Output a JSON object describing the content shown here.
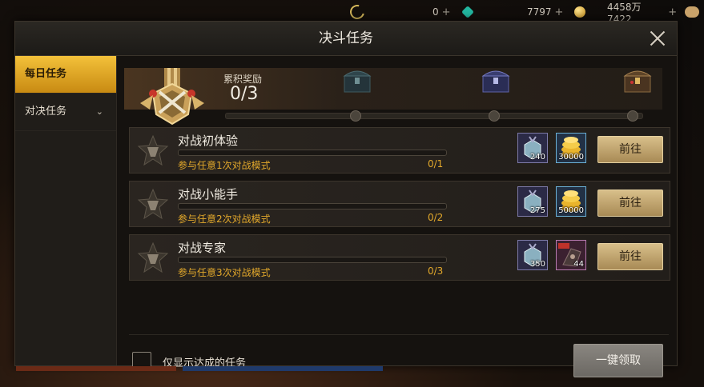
{
  "currencies": [
    {
      "icon": "moon-currency-icon",
      "value": "",
      "plus": ""
    },
    {
      "icon": "gem-currency-icon",
      "value": "0",
      "plus": "+"
    },
    {
      "icon": "diamond-currency-icon",
      "value": "7797",
      "plus": "+"
    },
    {
      "icon": "gold-coin-icon",
      "value": "4458万7422",
      "plus": "+"
    }
  ],
  "dialog": {
    "title": "决斗任务"
  },
  "sidebar": {
    "items": [
      {
        "label": "每日任务",
        "active": true
      },
      {
        "label": "对决任务",
        "chevron": "⌄"
      }
    ]
  },
  "accumulated": {
    "label": "累积奖励",
    "value": "0/3",
    "milestones": [
      "1",
      "2",
      "3"
    ]
  },
  "tasks": [
    {
      "title": "对战初体验",
      "desc": "参与任意1次对战模式",
      "count": "0/1",
      "progress": 0,
      "rewards": [
        {
          "icon": "silver-medal-icon",
          "qty": "240",
          "type": "medal"
        },
        {
          "icon": "gold-coins-icon",
          "qty": "30000",
          "type": "gold"
        }
      ],
      "button": "前往"
    },
    {
      "title": "对战小能手",
      "desc": "参与任意2次对战模式",
      "count": "0/2",
      "progress": 0,
      "rewards": [
        {
          "icon": "silver-medal-icon",
          "qty": "275",
          "type": "medal"
        },
        {
          "icon": "gold-coins-icon",
          "qty": "50000",
          "type": "gold"
        }
      ],
      "button": "前往"
    },
    {
      "title": "对战专家",
      "desc": "参与任意3次对战模式",
      "count": "0/3",
      "progress": 0,
      "rewards": [
        {
          "icon": "silver-medal-icon",
          "qty": "350",
          "type": "medal"
        },
        {
          "icon": "mystery-item-icon",
          "qty": "44",
          "type": "red"
        }
      ],
      "button": "前往"
    }
  ],
  "footer": {
    "checkbox_label": "仅显示达成的任务",
    "claim_all": "一键领取"
  },
  "colors": {
    "accent_gold": "#e3a92b",
    "active_tab": "#f3c13a"
  }
}
